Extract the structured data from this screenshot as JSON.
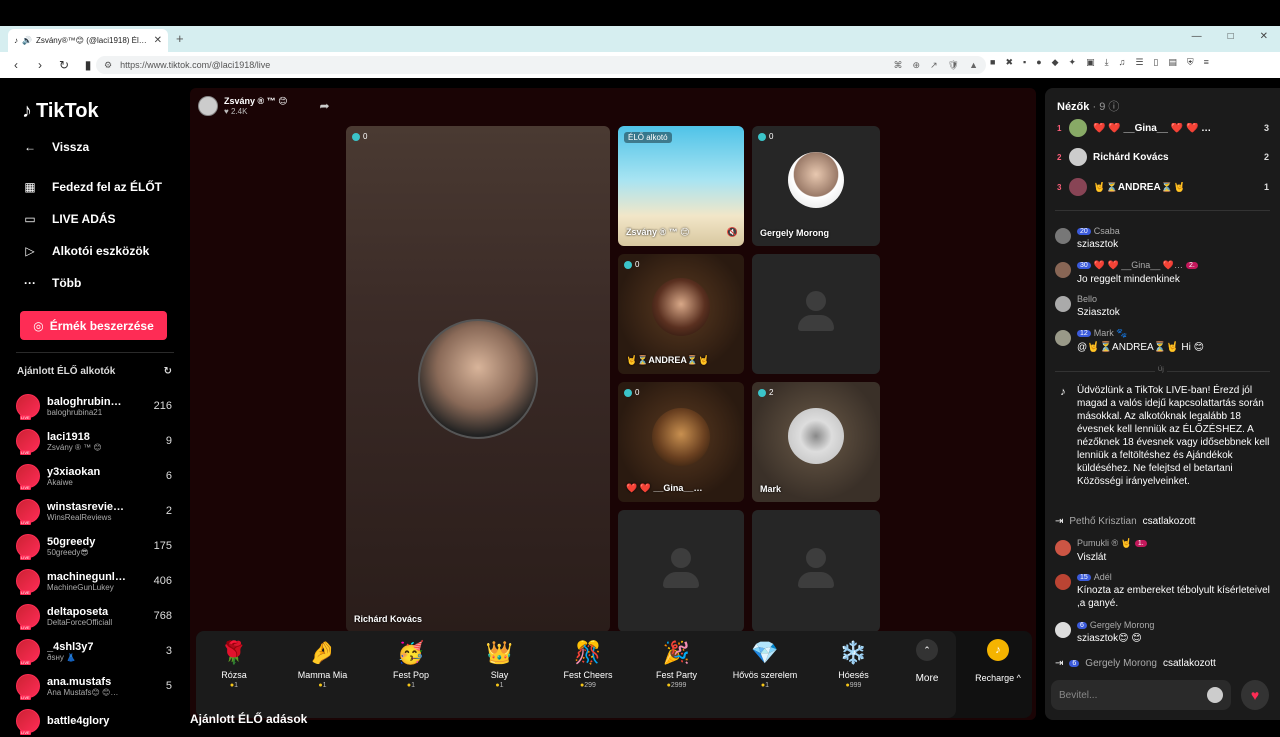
{
  "browser": {
    "tab_title": "Zsvány®™😊 (@laci1918) Él…",
    "url": "https://www.tiktok.com/@laci1918/live",
    "new_tab": "+",
    "win_min": "—",
    "win_max": "□",
    "win_close": "✕"
  },
  "sidebar": {
    "logo": "TikTok",
    "back": "Vissza",
    "items": [
      {
        "label": "Fedezd fel az ÉLŐT"
      },
      {
        "label": "LIVE ADÁS"
      },
      {
        "label": "Alkotói eszközök"
      },
      {
        "label": "Több"
      }
    ],
    "coins_button": "Érmék beszerzése",
    "recommended_title": "Ajánlott ÉLŐ alkotók",
    "creators": [
      {
        "name": "baloghrubin…",
        "handle": "baloghrubina21",
        "count": "216"
      },
      {
        "name": "laci1918",
        "handle": "Zsvány ® ™ 😊",
        "count": "9"
      },
      {
        "name": "y3xiaokan",
        "handle": "Akaiwe",
        "count": "6"
      },
      {
        "name": "winstasrevie…",
        "handle": "WinsRealReviews",
        "count": "2"
      },
      {
        "name": "50greedy",
        "handle": "50greedy😎",
        "count": "175"
      },
      {
        "name": "machinegunl…",
        "handle": "MachineGunLukey",
        "count": "406"
      },
      {
        "name": "deltaposeta",
        "handle": "DeltaForceOfficiall",
        "count": "768"
      },
      {
        "name": "_4shl3y7",
        "handle": "ðsнy 👗",
        "count": "3"
      },
      {
        "name": "ana.mustafs",
        "handle": "Ana Mustafs😊 😊…",
        "count": "5"
      },
      {
        "name": "battle4glory",
        "handle": "",
        "count": ""
      }
    ]
  },
  "stage": {
    "host_name": "Zsvány ® ™ 😊",
    "host_likes": "♥ 2.4K",
    "main_tile": {
      "badge": "0",
      "name": "Richárd Kovács"
    },
    "tiles": [
      {
        "label": "ÉLŐ alkotó",
        "name": "Zsvány ® ™ 😊",
        "badge": ""
      },
      {
        "badge": "0",
        "name": "Gergely Morong"
      },
      {
        "badge": "0",
        "name": "🤘⏳ANDREA⏳🤘"
      },
      {
        "badge": "",
        "name": ""
      },
      {
        "badge": "0",
        "name": "❤️ ❤️ __Gina__…"
      },
      {
        "badge": "2",
        "name": "Mark"
      },
      {
        "badge": "",
        "name": ""
      },
      {
        "badge": "",
        "name": ""
      }
    ]
  },
  "gifts": [
    {
      "name": "Rózsa",
      "price": "1",
      "icon": "🌹"
    },
    {
      "name": "Mamma Mia",
      "price": "1",
      "icon": "🤌"
    },
    {
      "name": "Fest Pop",
      "price": "1",
      "icon": "🥳"
    },
    {
      "name": "Slay",
      "price": "1",
      "icon": "👑"
    },
    {
      "name": "Fest Cheers",
      "price": "299",
      "icon": "🎊"
    },
    {
      "name": "Fest Party",
      "price": "2999",
      "icon": "🎉"
    },
    {
      "name": "Hővös szerelem",
      "price": "1",
      "icon": "💎"
    },
    {
      "name": "Hóesés",
      "price": "999",
      "icon": "❄️"
    }
  ],
  "more_label": "More",
  "recharge_label": "Recharge ^",
  "bottom_title": "Ajánlott ÉLŐ adások",
  "panel": {
    "title": "Nézők",
    "count": "· 9",
    "viewers": [
      {
        "rank": "1",
        "name": "❤️ ❤️ __Gina__ ❤️ ❤️ …",
        "score": "3"
      },
      {
        "rank": "2",
        "name": "Richárd Kovács",
        "score": "2"
      },
      {
        "rank": "3",
        "name": "🤘⏳ANDREA⏳🤘",
        "score": "1"
      }
    ],
    "sep_label": "Új",
    "messages": [
      {
        "lvl": "20",
        "user": "Csaba",
        "text": "sziasztok"
      },
      {
        "lvl": "30",
        "user": "❤️ ❤️ __Gina__ ❤️…",
        "fan": "2.",
        "text": "Jo reggelt mindenkinek"
      },
      {
        "lvl": "",
        "user": "Bello",
        "text": "Sziasztok"
      },
      {
        "lvl": "12",
        "user": "Mark 🐾",
        "text": "@🤘⏳ANDREA⏳🤘 Hi 😊"
      }
    ],
    "system_msg": "Üdvözlünk a TikTok LIVE-ban! Érezd jól magad a valós idejű kapcsolattartás során másokkal. Az alkotóknak legalább 18 évesnek kell lenniük az ÉLŐZÉSHEZ. A nézőknek 18 évesnek vagy idősebbnek kell lenniük a feltöltéshez és Ajándékok küldéséhez. Ne felejtsd el betartani Közösségi irányelveinket.",
    "joined_1": {
      "name": "Pethő Krisztian",
      "text": "csatlakozott"
    },
    "messages2": [
      {
        "lvl": "",
        "user": "Pumukli ® 🤘",
        "fan": "1.",
        "text": "Viszlát"
      },
      {
        "lvl": "15",
        "user": "Adél",
        "text": "Kínozta az embereket tébolyult kísérleteivel ,a ganyé."
      },
      {
        "lvl": "6",
        "user": "Gergely Morong",
        "text": "sziasztok😊 😊"
      }
    ],
    "joined_2": {
      "lvl": "6",
      "name": "Gergely Morong",
      "text": "csatlakozott"
    },
    "input_placeholder": "Bevitel..."
  }
}
